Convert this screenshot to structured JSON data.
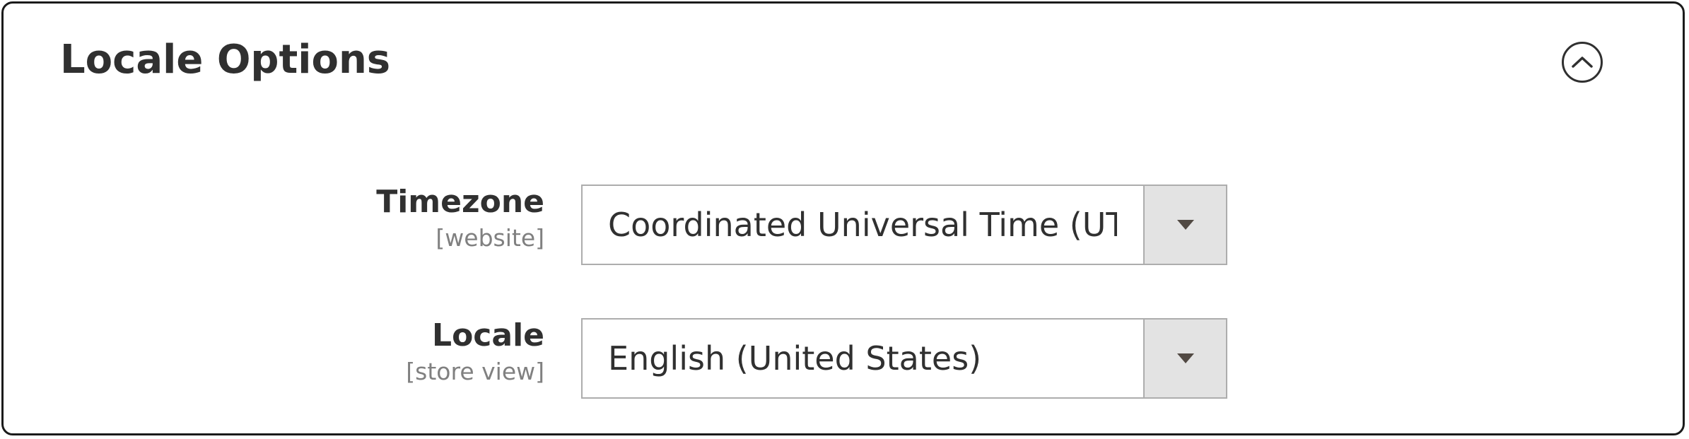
{
  "section": {
    "title": "Locale Options",
    "toggle_icon": "chevron-up-circle-icon"
  },
  "fields": [
    {
      "label": "Timezone",
      "scope": "[website]",
      "value": "Coordinated Universal Time (UTC)",
      "icon": "dropdown-arrow-icon"
    },
    {
      "label": "Locale",
      "scope": "[store view]",
      "value": "English (United States)",
      "icon": "dropdown-arrow-icon"
    }
  ],
  "colors": {
    "border": "#1b1b1b",
    "text": "#303030",
    "scope_text": "#808080",
    "select_border": "#adadad",
    "arrow_bg": "#e3e3e3"
  }
}
